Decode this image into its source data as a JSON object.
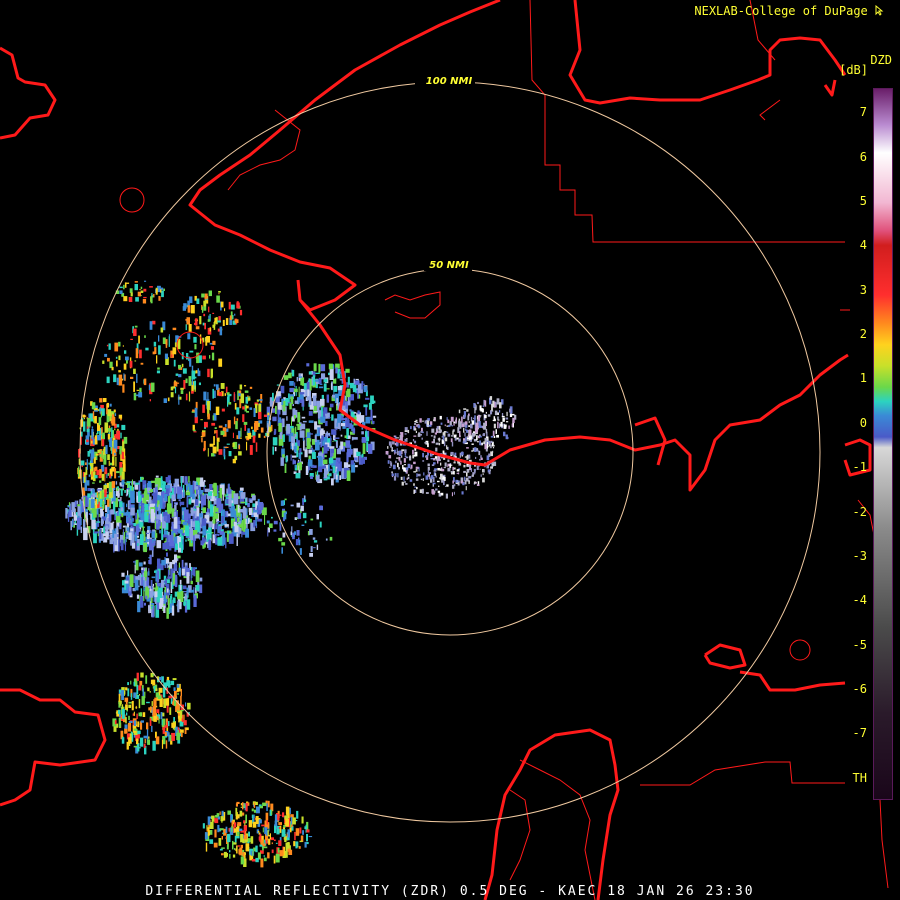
{
  "header": {
    "credit": "NEXLAB-College of DuPage",
    "credit_icon": "cursor-arrow-icon"
  },
  "footer": {
    "caption": "DIFFERENTIAL REFLECTIVITY (ZDR) 0.5 DEG - KAEC 18 JAN 26 23:30"
  },
  "colorbar": {
    "title": "DZD",
    "unit": "[dB]",
    "labels": [
      "7",
      "6",
      "5",
      "4",
      "3",
      "2",
      "1",
      "0",
      "-1",
      "-2",
      "-3",
      "-4",
      "-5",
      "-6",
      "-7",
      "TH"
    ]
  },
  "range_rings": [
    {
      "label": "100 NMI"
    },
    {
      "label": "50 NMI"
    }
  ],
  "colors": {
    "boundary": "#ff1a1a",
    "ring": "#f0c9a0",
    "label": "#ffff33",
    "background": "#000000"
  }
}
